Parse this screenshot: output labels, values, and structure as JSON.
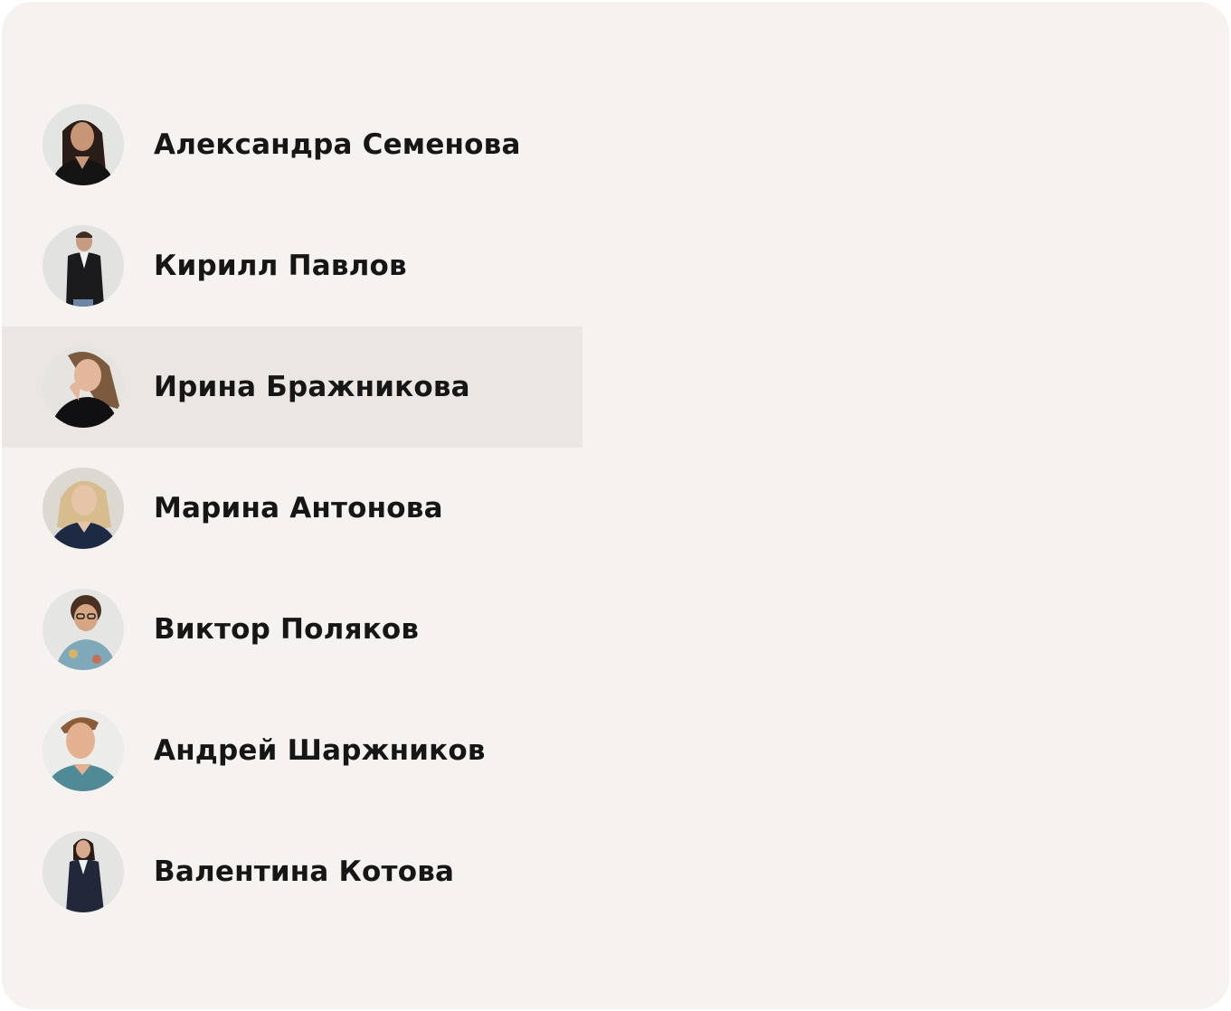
{
  "people": [
    {
      "name": "Александра Семенова",
      "selected": false,
      "avatar_icon": "woman-dark-hair-avatar-icon"
    },
    {
      "name": "Кирилл Павлов",
      "selected": false,
      "avatar_icon": "man-dark-jacket-avatar-icon"
    },
    {
      "name": "Ирина Бражникова",
      "selected": true,
      "avatar_icon": "woman-long-hair-avatar-icon"
    },
    {
      "name": "Марина Антонова",
      "selected": false,
      "avatar_icon": "woman-blonde-avatar-icon"
    },
    {
      "name": "Виктор Поляков",
      "selected": false,
      "avatar_icon": "man-curly-hair-avatar-icon"
    },
    {
      "name": "Андрей Шаржников",
      "selected": false,
      "avatar_icon": "man-teal-shirt-avatar-icon"
    },
    {
      "name": "Валентина Котова",
      "selected": false,
      "avatar_icon": "woman-suit-avatar-icon"
    }
  ],
  "colors": {
    "panel_background": "#f6f2ef",
    "selected_row_background": "#ebe6e1",
    "text": "#161616"
  }
}
